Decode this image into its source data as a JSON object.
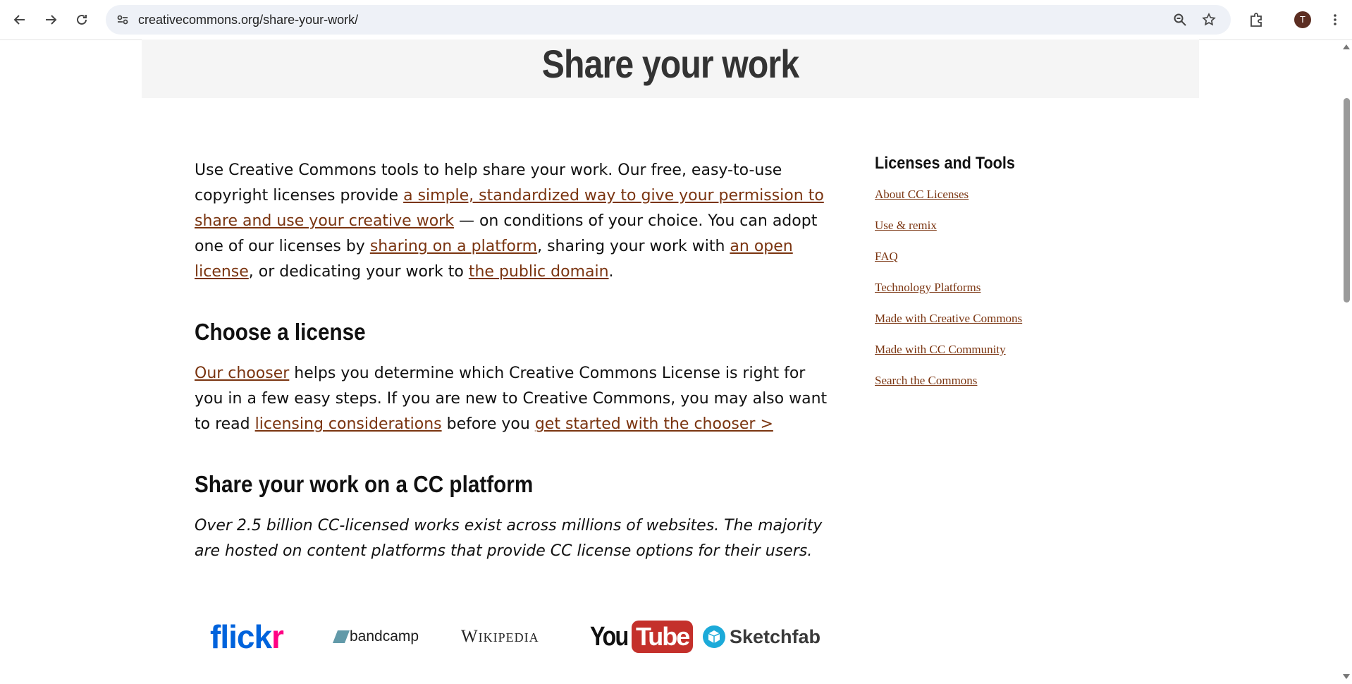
{
  "browser": {
    "url": "creativecommons.org/share-your-work/",
    "profile_initial": "T",
    "icons": [
      "back-icon",
      "forward-icon",
      "reload-icon",
      "site-settings-icon",
      "zoom-icon",
      "bookmark-star-icon",
      "extensions-icon",
      "menu-icon"
    ]
  },
  "page": {
    "title": "Share your work",
    "intro": {
      "t1": "Use Creative Commons tools to help share your work. Our free, easy-to-use copyright licenses provide ",
      "l1": "a simple, standardized way to give your permission to share and use your creative work",
      "t2": " — on conditions of your choice. You can adopt one of our licenses by ",
      "l2": "sharing on a platform",
      "t3": ", sharing your work with ",
      "l3": "an open license",
      "t4": ", or dedicating your work to ",
      "l4": "the public domain",
      "t5": "."
    },
    "choose": {
      "heading": "Choose a license",
      "l1": "Our chooser",
      "t1": " helps you determine which Creative Commons License is right for you in a few easy steps. If you are new to Creative Commons, you may also want to read ",
      "l2": "licensing considerations",
      "t2": " before you ",
      "l3": "get started with the chooser >"
    },
    "platform": {
      "heading": "Share your work on a CC platform",
      "text": "Over 2.5 billion CC-licensed works exist across millions of websites. The majority are hosted on content platforms that provide CC license options for their users."
    },
    "logos": {
      "flickr": "flickr",
      "bandcamp": "bandcamp",
      "wikipedia": "Wikipedia",
      "youtube_you": "You",
      "youtube_tube": "Tube",
      "sketchfab": "Sketchfab"
    }
  },
  "sidebar": {
    "heading": "Licenses and Tools",
    "links": [
      "About CC Licenses",
      "Use & remix",
      "FAQ",
      "Technology Platforms",
      "Made with Creative Commons",
      "Made with CC Community",
      "Search the Commons"
    ]
  }
}
